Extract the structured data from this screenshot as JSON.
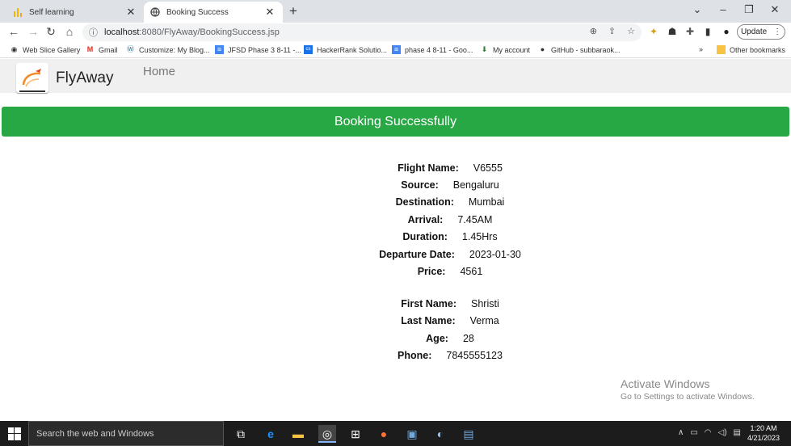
{
  "browser": {
    "tabs": [
      {
        "title": "Self learning",
        "active": false,
        "icon": "bar-chart-icon"
      },
      {
        "title": "Booking Success",
        "active": true,
        "icon": "globe-icon"
      }
    ],
    "url_host": "localhost",
    "url_path": ":8080/FlyAway/BookingSuccess.jsp",
    "update_label": "Update",
    "bookmarks": [
      "Web Slice Gallery",
      "Gmail",
      "Customize: My Blog...",
      "JFSD Phase 3 8-11 -...",
      "HackerRank Solutio...",
      "phase 4 8-11 - Goo...",
      "My account",
      "GitHub - subbaraok..."
    ],
    "bookmarks_more": "»",
    "other_bookmarks": "Other bookmarks"
  },
  "site": {
    "brand": "FlyAway",
    "nav_home": "Home"
  },
  "banner": "Booking Successfully",
  "flight": {
    "flight_name_label": "Flight Name:",
    "flight_name": "V6555",
    "source_label": "Source:",
    "source": "Bengaluru",
    "destination_label": "Destination:",
    "destination": "Mumbai",
    "arrival_label": "Arrival:",
    "arrival": "7.45AM",
    "duration_label": "Duration:",
    "duration": "1.45Hrs",
    "departure_label": "Departure Date:",
    "departure": "2023-01-30",
    "price_label": "Price:",
    "price": "4561"
  },
  "passenger": {
    "first_name_label": "First Name:",
    "first_name": "Shristi",
    "last_name_label": "Last Name:",
    "last_name": "Verma",
    "age_label": "Age:",
    "age": "28",
    "phone_label": "Phone:",
    "phone": "7845555123"
  },
  "watermark": {
    "line1": "Activate Windows",
    "line2": "Go to Settings to activate Windows."
  },
  "taskbar": {
    "search_placeholder": "Search the web and Windows",
    "time": "1:20 AM",
    "date": "4/21/2023"
  },
  "colors": {
    "banner_green": "#28a745",
    "navbar_bg": "#f0f0f0",
    "tabbar_bg": "#dee1e6",
    "taskbar_bg": "#1c1c1c"
  }
}
